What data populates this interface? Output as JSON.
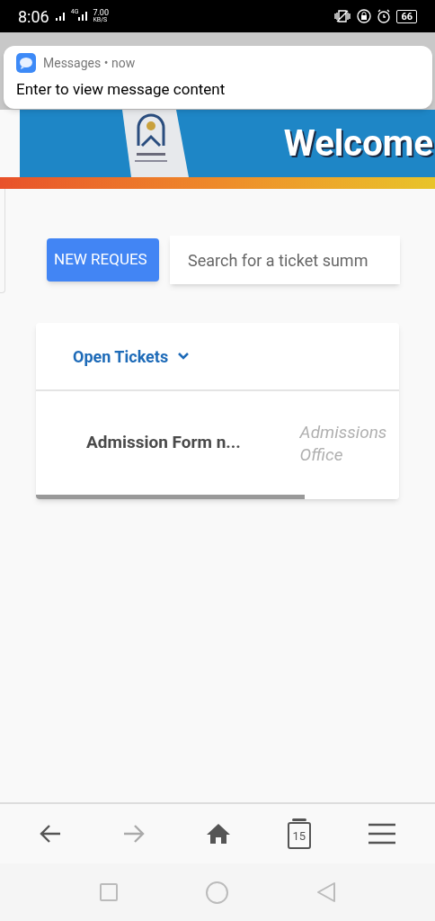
{
  "status_bar": {
    "time": "8:06",
    "network": "4G",
    "speed": "7.00",
    "speed_unit": "KB/S",
    "battery": "66"
  },
  "notification": {
    "app": "Messages",
    "separator": "•",
    "time": "now",
    "message": "Enter to view message content"
  },
  "banner": {
    "title": "Welcome"
  },
  "new_request_button": "NEW REQUES",
  "search": {
    "placeholder": "Search for a ticket summ"
  },
  "tickets": {
    "filter": "Open Tickets",
    "rows": [
      {
        "title": "Admission Form n...",
        "department": "Admissions Office"
      }
    ]
  },
  "browser_nav": [
    {
      "kind": "back",
      "disabled": false
    },
    {
      "kind": "forward",
      "disabled": true
    },
    {
      "kind": "home",
      "disabled": false
    },
    {
      "kind": "tabs",
      "label": "15",
      "disabled": false
    },
    {
      "kind": "menu",
      "disabled": false
    }
  ]
}
